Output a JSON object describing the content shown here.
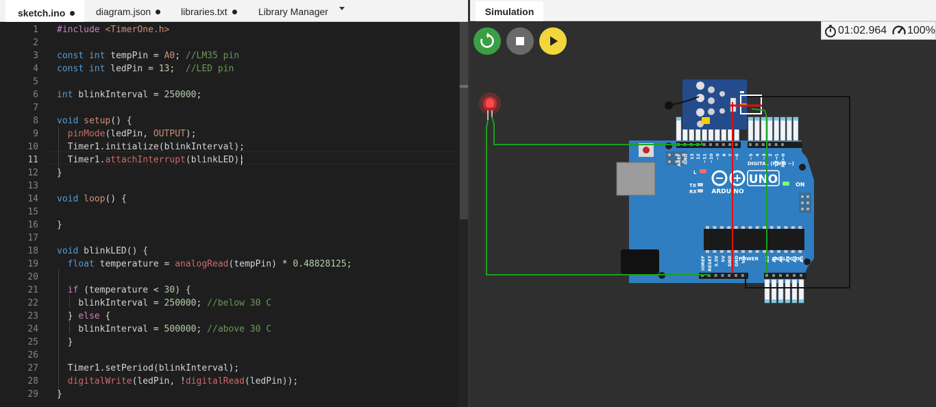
{
  "editor": {
    "tabs": [
      {
        "label": "sketch.ino",
        "active": true,
        "unsaved": true
      },
      {
        "label": "diagram.json",
        "active": false,
        "unsaved": true
      },
      {
        "label": "libraries.txt",
        "active": false,
        "unsaved": true
      },
      {
        "label": "Library Manager",
        "active": false,
        "unsaved": false
      }
    ],
    "cursor_line": 11,
    "lines": [
      {
        "n": "1",
        "text": "#include <TimerOne.h>"
      },
      {
        "n": "2",
        "text": ""
      },
      {
        "n": "3",
        "text": "const int tempPin = A0; //LM35 pin"
      },
      {
        "n": "4",
        "text": "const int ledPin = 13;  //LED pin"
      },
      {
        "n": "5",
        "text": ""
      },
      {
        "n": "6",
        "text": "int blinkInterval = 250000;"
      },
      {
        "n": "7",
        "text": ""
      },
      {
        "n": "8",
        "text": "void setup() {"
      },
      {
        "n": "9",
        "text": "  pinMode(ledPin, OUTPUT);"
      },
      {
        "n": "10",
        "text": "  Timer1.initialize(blinkInterval);"
      },
      {
        "n": "11",
        "text": "  Timer1.attachInterrupt(blinkLED);"
      },
      {
        "n": "12",
        "text": "}"
      },
      {
        "n": "13",
        "text": ""
      },
      {
        "n": "14",
        "text": "void loop() {"
      },
      {
        "n": "15",
        "text": ""
      },
      {
        "n": "16",
        "text": "}"
      },
      {
        "n": "17",
        "text": ""
      },
      {
        "n": "18",
        "text": "void blinkLED() {"
      },
      {
        "n": "19",
        "text": "  float temperature = analogRead(tempPin) * 0.48828125;"
      },
      {
        "n": "20",
        "text": ""
      },
      {
        "n": "21",
        "text": "  if (temperature < 30) {"
      },
      {
        "n": "22",
        "text": "    blinkInterval = 250000; //below 30 C"
      },
      {
        "n": "23",
        "text": "  } else {"
      },
      {
        "n": "24",
        "text": "    blinkInterval = 500000; //above 30 C"
      },
      {
        "n": "25",
        "text": "  }"
      },
      {
        "n": "26",
        "text": ""
      },
      {
        "n": "27",
        "text": "  Timer1.setPeriod(blinkInterval);"
      },
      {
        "n": "28",
        "text": "  digitalWrite(ledPin, !digitalRead(ledPin));"
      },
      {
        "n": "29",
        "text": "}"
      }
    ]
  },
  "simulation": {
    "tab_label": "Simulation",
    "controls": {
      "restart_icon": "restart-icon",
      "stop_icon": "stop-icon",
      "play_icon": "play-icon",
      "restart_color": "#3a9f44",
      "stop_color": "#6a6a6a",
      "play_color": "#f3d53c"
    },
    "timer": "01:02.964",
    "speed": "100%",
    "board": {
      "name": "ARDUINO",
      "model": "UNO",
      "on_label": "ON",
      "l_label": "L",
      "tx_label": "TX",
      "rx_label": "RX",
      "digital_label": "DIGITAL (PWM ~)",
      "power_label": "POWER",
      "analog_label": "ANALOG IN",
      "digital_pins": [
        "AREF",
        "GND",
        "13",
        "12",
        "~11",
        "~10",
        "~9",
        "8",
        "7",
        "~6",
        "~5",
        "4",
        "~3",
        "2",
        "TX→1",
        "RX←0"
      ],
      "power_pins": [
        "IOREF",
        "RESET",
        "3.3V",
        "5V",
        "GND",
        "GND",
        "Vin"
      ],
      "analog_pins": [
        "A0",
        "A1",
        "A2",
        "A3",
        "A4",
        "A5"
      ]
    },
    "colors": {
      "board": "#2f7ec1",
      "wire_green": "#1ca21c",
      "wire_red": "#e01010",
      "wire_black": "#111111",
      "led": "#ff3b3b"
    }
  }
}
